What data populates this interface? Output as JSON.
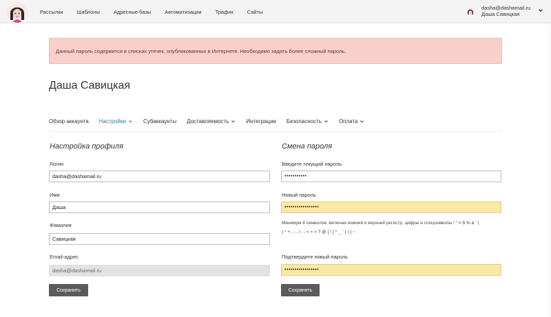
{
  "nav": {
    "items": [
      {
        "label": "Рассылки"
      },
      {
        "label": "Шаблоны"
      },
      {
        "label": "Адресные базы"
      },
      {
        "label": "Автоматизации"
      },
      {
        "label": "Трафик"
      },
      {
        "label": "Сайты"
      }
    ]
  },
  "user": {
    "email": "dasha@dashamail.ru",
    "name": "Даша Савицкая",
    "chevron_icon": "chevron-down-icon"
  },
  "alert": {
    "text": "Данный пароль содержится в списках утечек, опубликованных в Интернете. Необходимо задать более сложный пароль."
  },
  "page": {
    "title": "Даша Савицкая"
  },
  "tabs": [
    {
      "label": "Обзор аккаунта",
      "active": false,
      "dropdown": false
    },
    {
      "label": "Настройки",
      "active": true,
      "dropdown": true
    },
    {
      "label": "Субаккаунты",
      "active": false,
      "dropdown": false
    },
    {
      "label": "Доставляемость",
      "active": false,
      "dropdown": true
    },
    {
      "label": "Интеграции",
      "active": false,
      "dropdown": false
    },
    {
      "label": "Безопасность",
      "active": false,
      "dropdown": true
    },
    {
      "label": "Оплата",
      "active": false,
      "dropdown": true
    }
  ],
  "profile": {
    "title": "Настройка профиля",
    "login_label": "Логин",
    "login_value": "dasha@dashamail.ru",
    "name_label": "Имя",
    "name_value": "Даша",
    "surname_label": "Фамилия",
    "surname_value": "Савицкая",
    "email_label": "Email-адрес",
    "email_value": "dasha@dashamail.ru",
    "save_label": "Сохранить"
  },
  "password": {
    "title": "Смена пароля",
    "current_label": "Введите текущий пароль",
    "current_value": "•••••••••••",
    "new_label": "Новый пароль",
    "new_value": "•••••••••••••••••",
    "hint_line1": "Минимум 8 символов, включая нижний и верхний регистр, цифры и спецсимволы ! \" # $ % & ' (",
    "hint_line2": ") * + , - . / : ; < = > ? @ [ \\ ] ^ _ ` { | } ~",
    "confirm_label": "Подтвердите новый пароль",
    "confirm_value": "•••••••••••••••••",
    "save_label": "Сохранить"
  },
  "colors": {
    "accent": "#2a7ab6",
    "alert_bg": "#f7cfcb",
    "warn_input_bg": "#fbe8a6",
    "button_bg": "#5b5b5b"
  }
}
